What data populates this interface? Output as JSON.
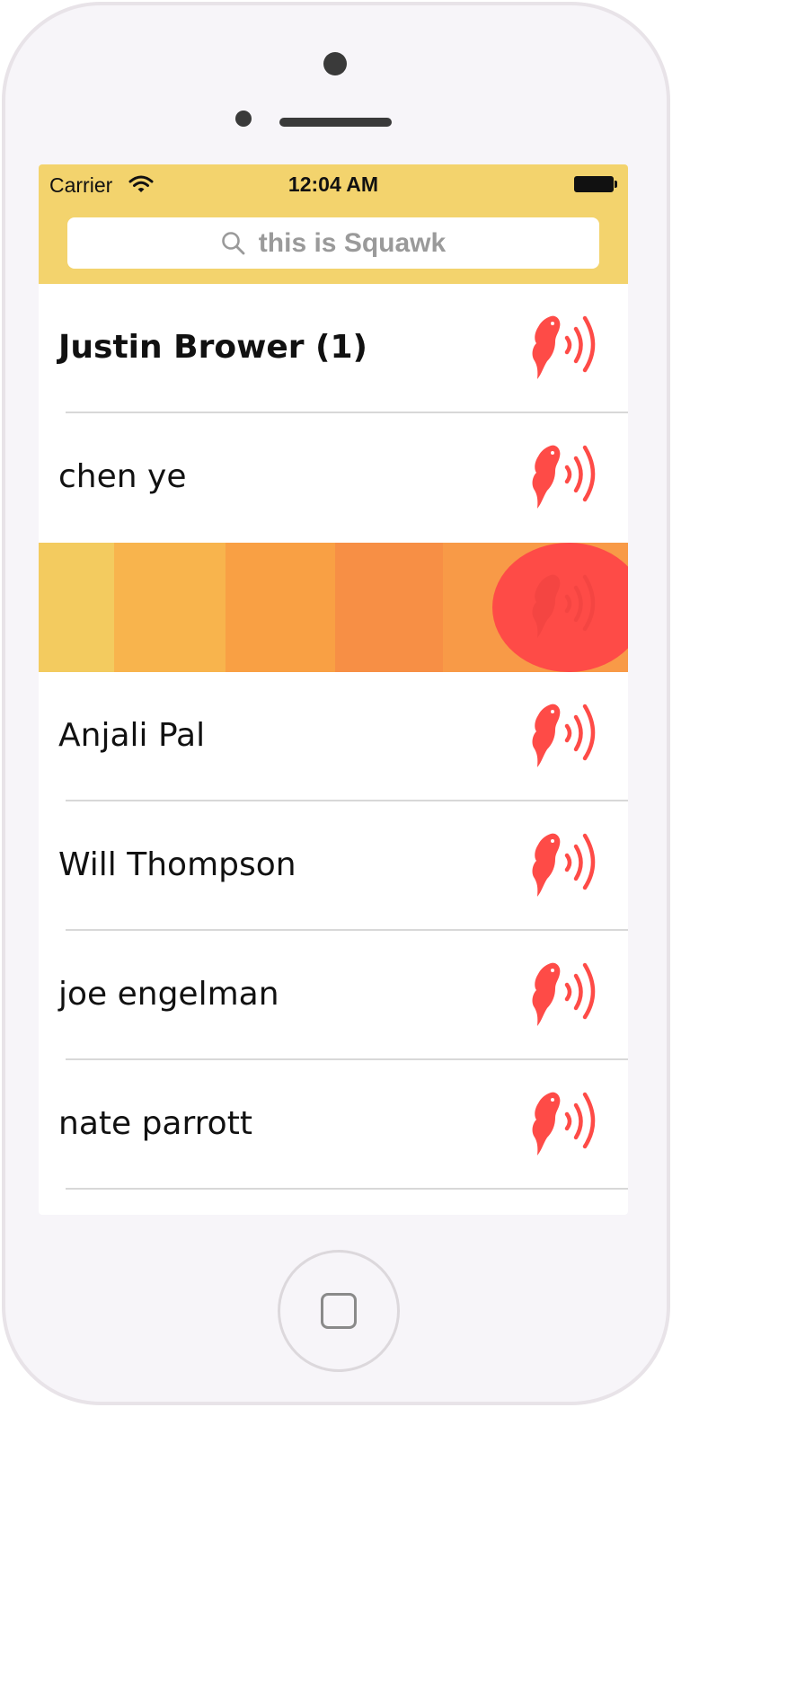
{
  "status_bar": {
    "carrier": "Carrier",
    "time": "12:04 AM"
  },
  "search": {
    "placeholder": "this is Squawk"
  },
  "colors": {
    "header": "#f3d36d",
    "accent": "#fe4b47",
    "divider": "#d8d8d8"
  },
  "contacts": [
    {
      "name": "Justin Brower (1)",
      "unread": true
    },
    {
      "name": "chen ye",
      "unread": false
    },
    {
      "name": "",
      "recording": true
    },
    {
      "name": "Anjali Pal",
      "unread": false
    },
    {
      "name": "Will Thompson",
      "unread": false
    },
    {
      "name": "joe engelman",
      "unread": false
    },
    {
      "name": "nate parrott",
      "unread": false
    }
  ],
  "icons": {
    "row_action": "parrot-squawk-icon",
    "search": "search-icon",
    "wifi": "wifi-icon",
    "battery": "battery-icon"
  }
}
